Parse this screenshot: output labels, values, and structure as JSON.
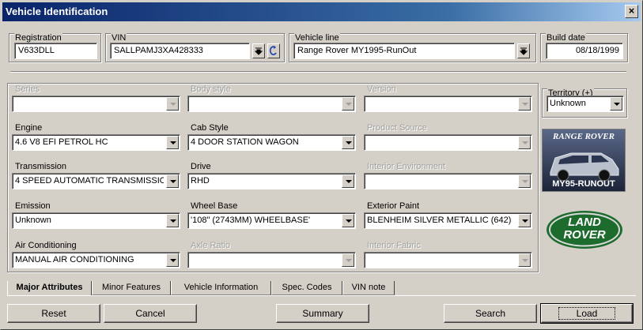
{
  "window": {
    "title": "Vehicle Identification",
    "close_glyph": "×"
  },
  "header": {
    "registration": {
      "label": "Registration",
      "value": "V633DLL"
    },
    "vin": {
      "label": "VIN",
      "value": "SALLPAMJ3XA428333"
    },
    "vehicle_line": {
      "label": "Vehicle line",
      "value": "Range Rover MY1995-RunOut"
    },
    "build_date": {
      "label": "Build date",
      "value": "08/18/1999"
    }
  },
  "attributes": {
    "series": {
      "label": "Series",
      "value": ""
    },
    "body_style": {
      "label": "Body style",
      "value": ""
    },
    "version": {
      "label": "Version",
      "value": ""
    },
    "territory": {
      "label": "Territory (+)",
      "value": "Unknown"
    },
    "engine": {
      "label": "Engine",
      "value": "4.6 V8 EFI PETROL HC"
    },
    "cab_style": {
      "label": "Cab Style",
      "value": "4 DOOR STATION WAGON"
    },
    "product_source": {
      "label": "Product Source",
      "value": ""
    },
    "transmission": {
      "label": "Transmission",
      "value": "4 SPEED AUTOMATIC TRANSMISSIO"
    },
    "drive": {
      "label": "Drive",
      "value": "RHD"
    },
    "interior_environment": {
      "label": "Interior Environment",
      "value": ""
    },
    "emission": {
      "label": "Emission",
      "value": "Unknown"
    },
    "wheel_base": {
      "label": "Wheel Base",
      "value": "'108\" (2743MM) WHEELBASE'"
    },
    "exterior_paint": {
      "label": "Exterior Paint",
      "value": "BLENHEIM SILVER METALLIC (642)"
    },
    "air_conditioning": {
      "label": "Air Conditioning",
      "value": "MANUAL AIR CONDITIONING"
    },
    "axle_ratio": {
      "label": "Axle Ratio",
      "value": ""
    },
    "interior_fabric": {
      "label": "Interior Fabric",
      "value": ""
    }
  },
  "logos": {
    "range_rover_top": "RANGE ROVER",
    "range_rover_bottom": "MY95-RUNOUT",
    "land_rover_line1": "LAND",
    "land_rover_line2": "ROVER"
  },
  "tabs": [
    {
      "label": "Major Attributes"
    },
    {
      "label": "Minor Features"
    },
    {
      "label": "Vehicle Information"
    },
    {
      "label": "Spec. Codes"
    },
    {
      "label": "VIN note"
    }
  ],
  "buttons": {
    "reset": "Reset",
    "cancel": "Cancel",
    "summary": "Summary",
    "search": "Search",
    "load": "Load"
  },
  "colors": {
    "titlebar_start": "#0a246a",
    "land_rover_green": "#1e6b2e",
    "range_rover_bg": "#2f3a55"
  }
}
